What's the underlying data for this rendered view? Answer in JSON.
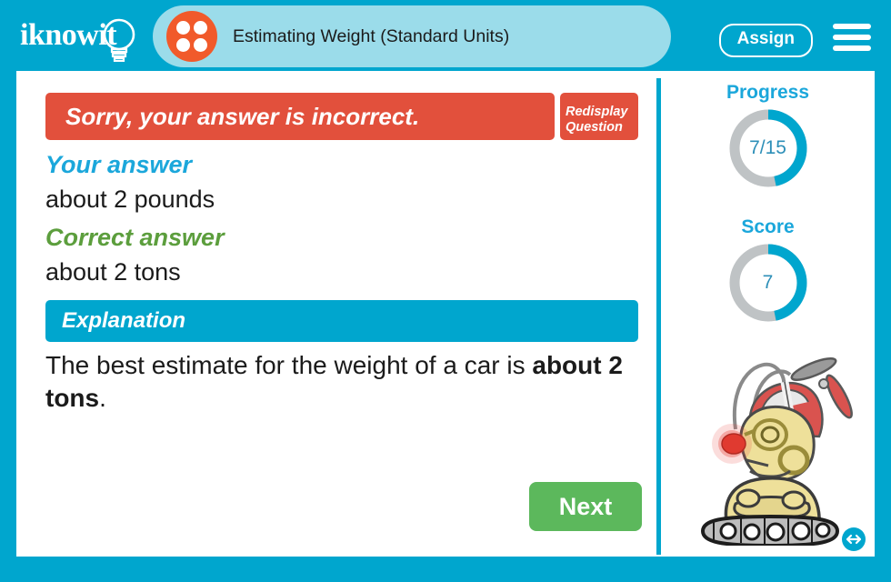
{
  "header": {
    "logo_text": "iknowit",
    "logo_icon": "lightbulb-icon",
    "title": "Estimating Weight (Standard Units)",
    "title_icon": "four-dots-circle-icon",
    "assign_label": "Assign",
    "menu_icon": "hamburger-menu-icon"
  },
  "feedback": {
    "banner_text": "Sorry, your answer is incorrect.",
    "redisplay_label": "Redisplay Question",
    "your_answer_label": "Your answer",
    "your_answer_value": "about 2 pounds",
    "correct_answer_label": "Correct answer",
    "correct_answer_value": "about 2 tons",
    "explanation_label": "Explanation",
    "explanation_prefix": "The best estimate for the weight of a car is ",
    "explanation_bold": "about 2 tons",
    "explanation_suffix": ".",
    "next_label": "Next"
  },
  "sidebar": {
    "progress_label": "Progress",
    "progress_value": "7/15",
    "progress_current": 7,
    "progress_total": 15,
    "score_label": "Score",
    "score_value": "7",
    "score_current": 7,
    "score_total": 15,
    "mascot_icon": "robot-mascot-propeller-hat",
    "resize_icon": "resize-horizontal-icon"
  },
  "colors": {
    "brand_cyan": "#00A6CE",
    "tab_cyan": "#9BDCEA",
    "incorrect_red": "#E2503C",
    "correct_green": "#5C9E3D",
    "next_green": "#5CB85C",
    "your_answer_blue": "#1BA7DB",
    "ring_track_gray": "#BFC3C5",
    "accent_orange": "#F15A2B"
  }
}
